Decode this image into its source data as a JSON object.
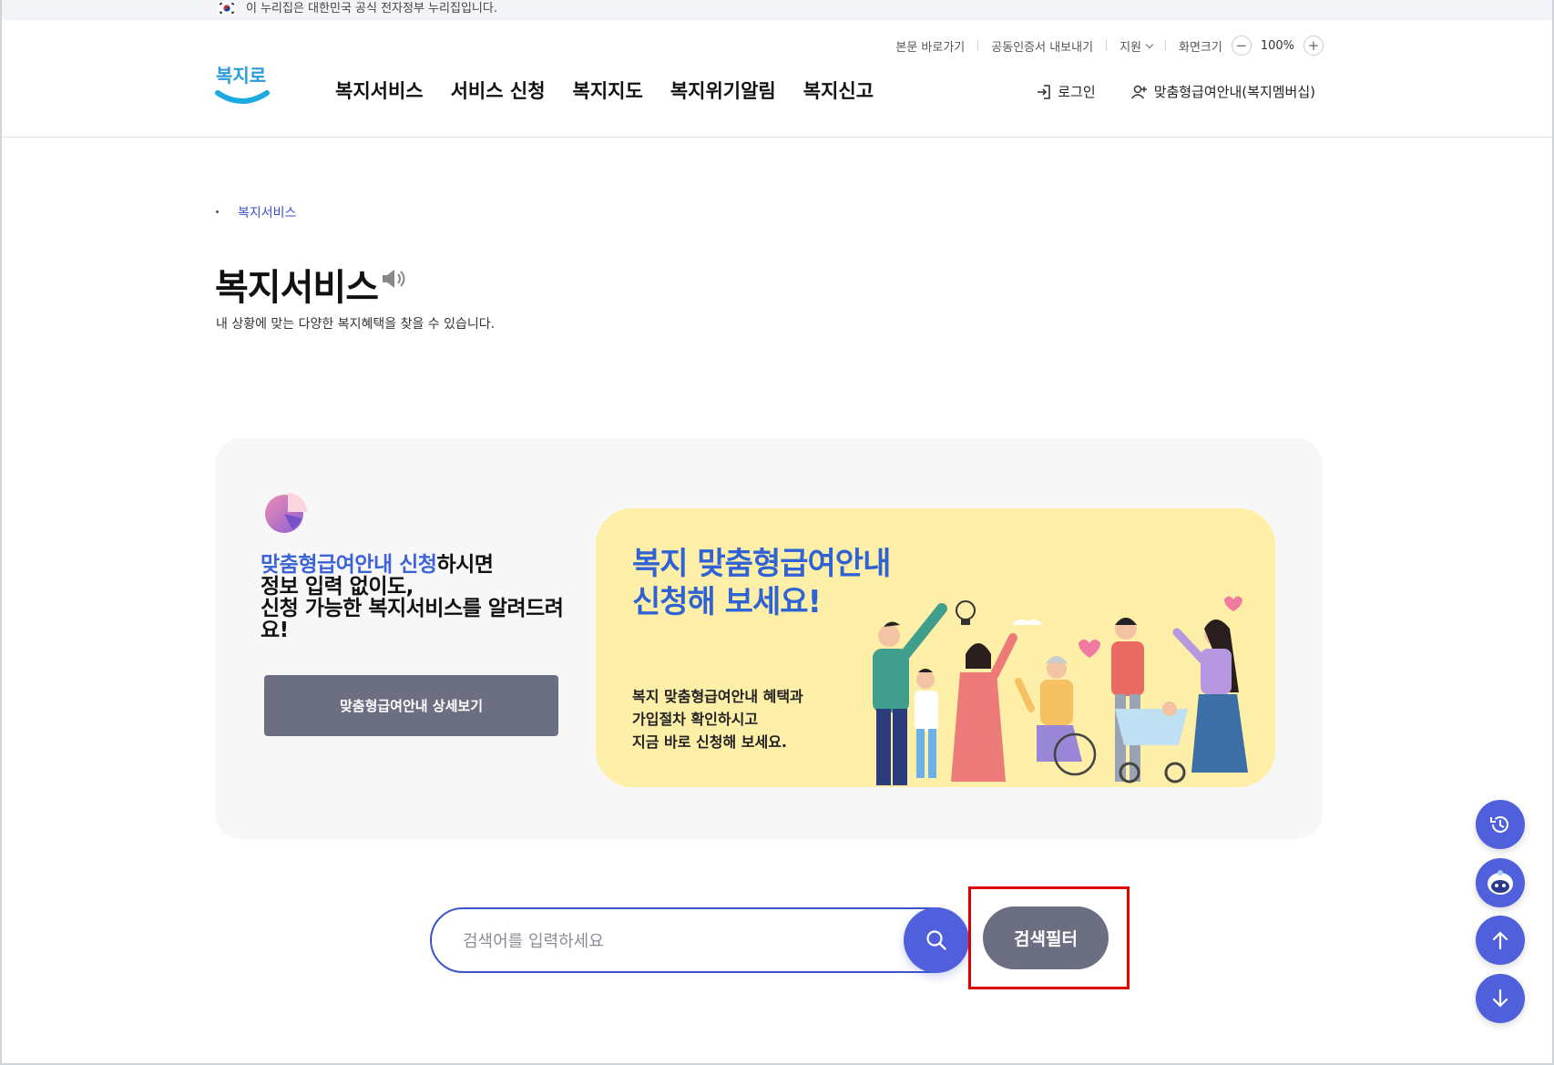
{
  "gov_banner": {
    "text": "이 누리집은 대한민국 공식 전자정부 누리집입니다."
  },
  "utility": {
    "skip_to_content": "본문 바로가기",
    "cert_export": "공동인증서 내보내기",
    "support": "지원",
    "screen_size": "화면크기",
    "zoom_value": "100%",
    "zoom_out": "−",
    "zoom_in": "+"
  },
  "header": {
    "logo_text": "복지로",
    "nav": [
      "복지서비스",
      "서비스 신청",
      "복지지도",
      "복지위기알림",
      "복지신고"
    ],
    "login": "로그인",
    "membership": "맞춤형급여안내(복지멤버십)"
  },
  "breadcrumb": {
    "item": "복지서비스"
  },
  "page": {
    "title": "복지서비스",
    "description": "내 상황에 맞는 다양한 복지혜택을 찾을 수 있습니다."
  },
  "promo": {
    "highlight": "맞춤형급여안내 신청",
    "line1_rest": "하시면",
    "line2": "정보 입력 없이도,",
    "line3": "신청 가능한 복지서비스를 알려드려요!",
    "button": "맞춤형급여안내 상세보기",
    "banner_title_1": "복지 맞춤형급여안내",
    "banner_title_2": "신청해 보세요!",
    "banner_desc_1": "복지 맞춤형급여안내 혜택과",
    "banner_desc_2": "가입절차 확인하시고",
    "banner_desc_3": "지금 바로 신청해 보세요."
  },
  "search": {
    "placeholder": "검색어를 입력하세요",
    "value": "",
    "filter_button": "검색필터"
  },
  "floating": {
    "icons": [
      "history-icon",
      "chatbot-icon",
      "scroll-top-icon",
      "scroll-bottom-icon"
    ]
  },
  "colors": {
    "brand_blue": "#5060dc",
    "highlight_blue": "#3d63d8",
    "button_gray": "#6c6f82",
    "banner_yellow": "#fdeea8",
    "annotation_red": "#e00000"
  }
}
